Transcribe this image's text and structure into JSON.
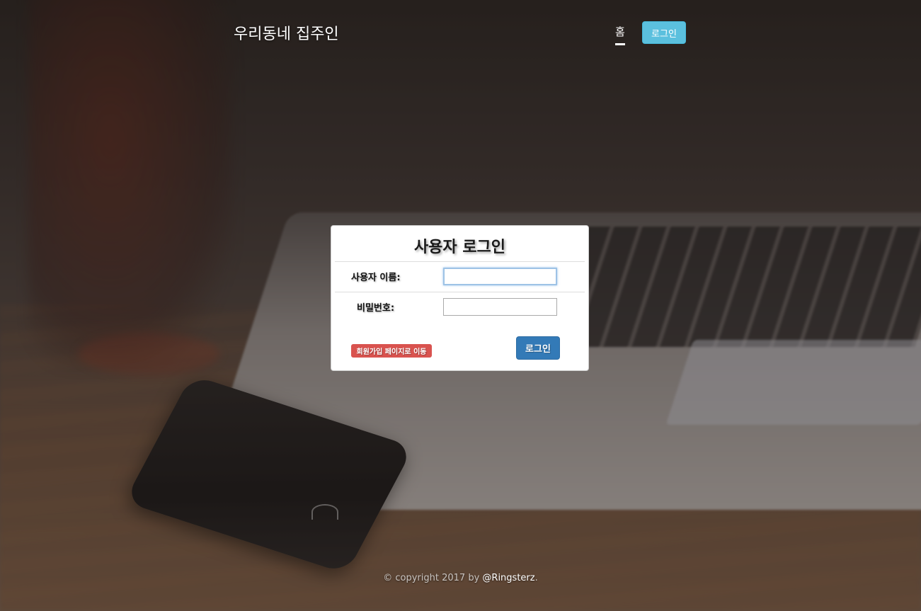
{
  "nav": {
    "brand": "우리동네 집주인",
    "home_label": "홈",
    "login_label": "로그인"
  },
  "login_form": {
    "title": "사용자 로그인",
    "username_label": "사용자 이름:",
    "username_value": "",
    "password_label": "비밀번호:",
    "password_value": "",
    "signup_label": "회원가입 페이지로 이동",
    "submit_label": "로그인"
  },
  "footer": {
    "copyright_prefix": "© copyright 2017 by ",
    "author": "@Ringsterz",
    "suffix": "."
  },
  "colors": {
    "nav_login_bg": "#5bc0de",
    "submit_bg": "#337ab7",
    "signup_bg": "#d9534f"
  }
}
